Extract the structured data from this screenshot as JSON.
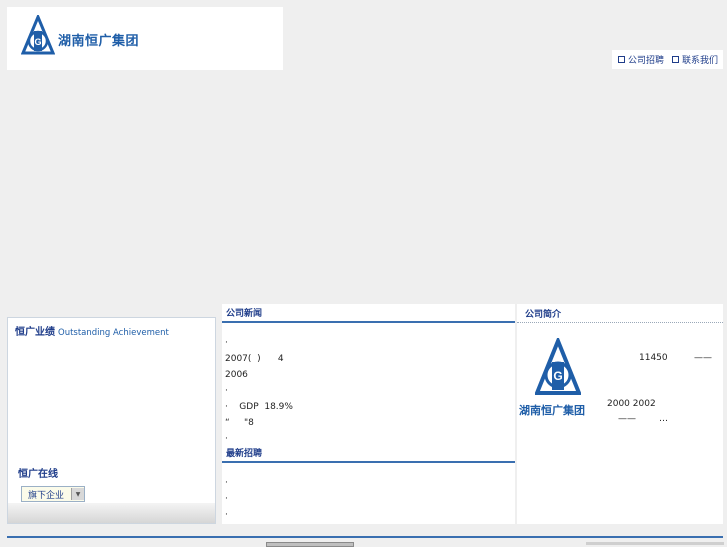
{
  "header": {
    "logo_text": "湖南恒广集团",
    "nav": [
      {
        "label": "公司招聘"
      },
      {
        "label": "联系我们"
      }
    ]
  },
  "achievement": {
    "title_cn": "恒广业绩",
    "title_en": "Outstanding Achievement"
  },
  "online": {
    "title": "恒广在线",
    "select_value": "旗下企业"
  },
  "news": {
    "title": "公司新闻",
    "items": [
      "·",
      "2007(  )      4",
      "2006",
      "·",
      "·    GDP  18.9%",
      "“     \"8",
      "·"
    ]
  },
  "recruit": {
    "title": "最新招聘",
    "items": [
      "·",
      "·",
      "·"
    ]
  },
  "intro": {
    "title": "公司简介",
    "logo_text": "湖南恒广集团",
    "line1": "11450",
    "line1_dash": "——",
    "line2": "2000  2002",
    "line3": "——",
    "line3_ellipsis": "…"
  },
  "colors": {
    "brand_blue": "#1f5ea8",
    "nav_blue": "#1f3d8a",
    "rule_blue": "#3a6fb0",
    "page_bg": "#efefef"
  }
}
